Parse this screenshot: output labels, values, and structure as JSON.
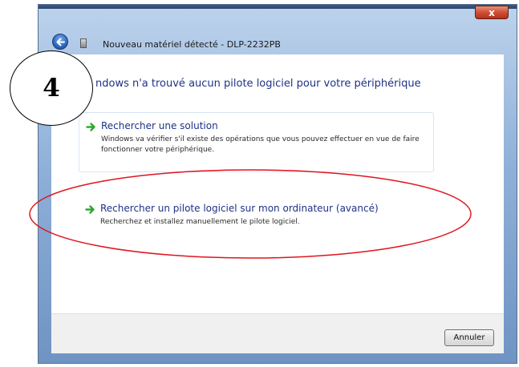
{
  "window": {
    "title": "Nouveau matériel détecté - DLP-2232PB",
    "close_label": "x"
  },
  "main": {
    "heading": "ndows n'a trouvé aucun pilote logiciel pour votre périphérique",
    "options": [
      {
        "title": "Rechercher une solution",
        "description": "Windows va vérifier s'il existe des opérations que vous pouvez effectuer en vue de faire fonctionner votre périphérique."
      },
      {
        "title": "Rechercher un pilote logiciel sur mon ordinateur (avancé)",
        "description": "Recherchez et installez manuellement le pilote logiciel."
      }
    ]
  },
  "footer": {
    "cancel_label": "Annuler"
  },
  "annotation": {
    "step_number": "4",
    "highlight_color": "#e0141e"
  },
  "colors": {
    "heading_blue": "#1e3287",
    "arrow_green": "#2ea82e",
    "title_bar_blue": "#8fb0d8"
  },
  "icons": {
    "back": "back-arrow-icon",
    "option_arrow": "green-arrow-icon",
    "app": "device-icon"
  }
}
